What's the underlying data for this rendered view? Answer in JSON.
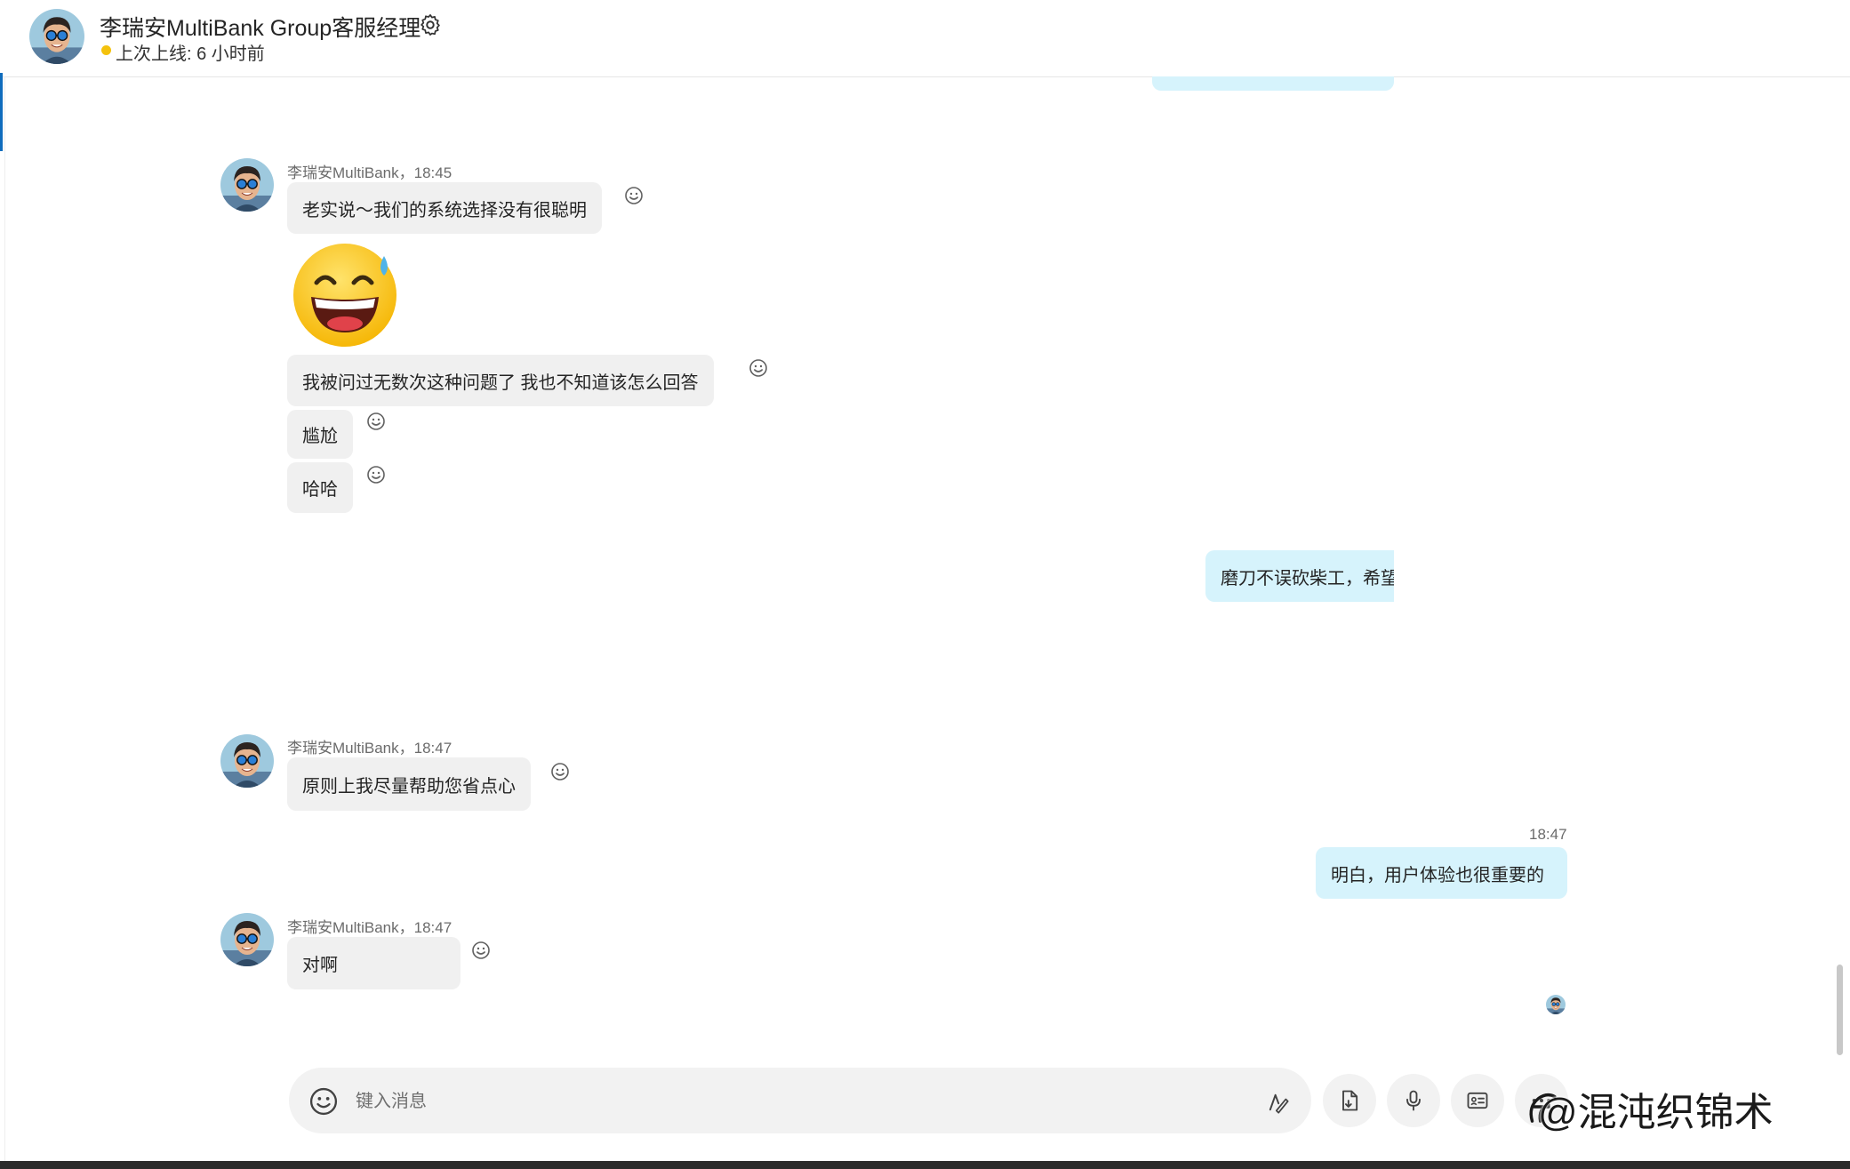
{
  "header": {
    "contact_name": "李瑞安MultiBank Group客服经理",
    "status": "上次上线: 6 小时前",
    "status_color": "#f4c20d"
  },
  "messages": [
    {
      "sender_meta": "李瑞安MultiBank，18:45",
      "bubbles": [
        "老实说～我们的系统选择没有很聪明",
        "我被问过无数次这种问题了  我也不知道该怎么回答",
        "尴尬",
        "哈哈"
      ],
      "emoji": "grinning-sweat-emoji"
    },
    {
      "outgoing_text": "磨刀不误砍柴工，希望"
    },
    {
      "sender_meta": "李瑞安MultiBank，18:47",
      "bubbles": [
        "原则上我尽量帮助您省点心"
      ]
    },
    {
      "outgoing_time": "18:47",
      "outgoing_text": "明白，用户体验也很重要的"
    },
    {
      "sender_meta": "李瑞安MultiBank，18:47",
      "bubbles": [
        "对啊"
      ]
    }
  ],
  "composer": {
    "placeholder": "键入消息",
    "icons": [
      "emoji-icon",
      "format-icon",
      "attach-file-icon",
      "microphone-icon",
      "contact-card-icon",
      "more-icon"
    ]
  },
  "watermark": "@混沌织锦术",
  "colors": {
    "accent": "#0f6cbd",
    "incoming_bubble": "#f0f0f0",
    "outgoing_bubble": "#d6f3fc"
  }
}
